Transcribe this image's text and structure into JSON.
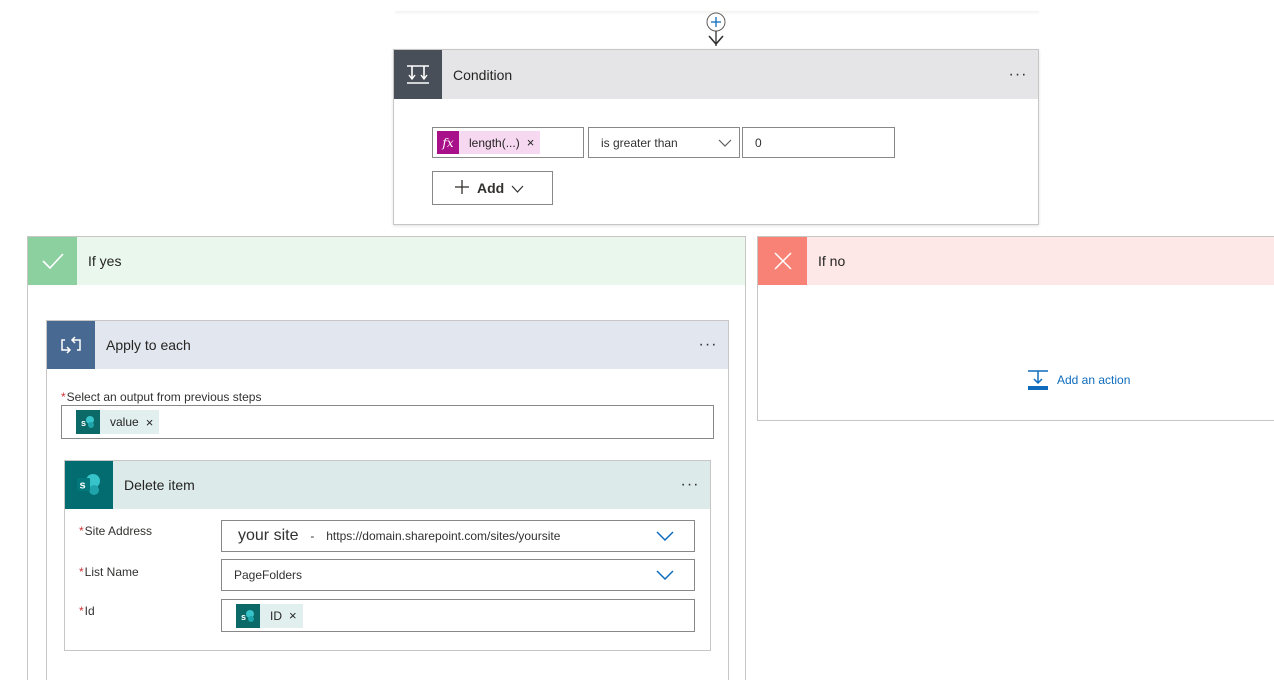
{
  "condition": {
    "title": "Condition",
    "more": "···",
    "expression_token": "length(...)",
    "expression_remove": "×",
    "fx_label": "fx",
    "operator": "is greater than",
    "value": "0",
    "add_label": "Add"
  },
  "branches": {
    "yes_title": "If yes",
    "no_title": "If no",
    "add_action_label": "Add an action"
  },
  "apply_each": {
    "title": "Apply to each",
    "more": "···",
    "output_label": "Select an output from previous steps",
    "required_mark": "*",
    "output_token": "value",
    "token_remove": "×",
    "sp_badge": "S"
  },
  "delete_item": {
    "title": "Delete item",
    "more": "···",
    "sp_badge": "S",
    "required_mark": "*",
    "site_address_label": "Site Address",
    "site_address_name": "your site",
    "site_address_sep": "-",
    "site_address_url": "https://domain.sharepoint.com/sites/yoursite",
    "list_name_label": "List Name",
    "list_name_value": "PageFolders",
    "id_label": "Id",
    "id_token": "ID",
    "token_remove": "×"
  },
  "colors": {
    "condition_icon_bg": "#484f58",
    "yes_accent": "#8cd0a0",
    "no_accent": "#f78275",
    "apply_accent": "#486991",
    "sharepoint_accent": "#036c70",
    "expression_accent": "#a8108a",
    "link_blue": "#0f6cbd"
  },
  "icons": {
    "connector": "plus-arrow-icon",
    "condition": "condition-icon",
    "yes": "checkmark-icon",
    "no": "close-icon",
    "apply": "loop-icon",
    "sharepoint": "sharepoint-icon",
    "add_action": "add-action-icon",
    "dropdown": "chevron-down-icon"
  }
}
